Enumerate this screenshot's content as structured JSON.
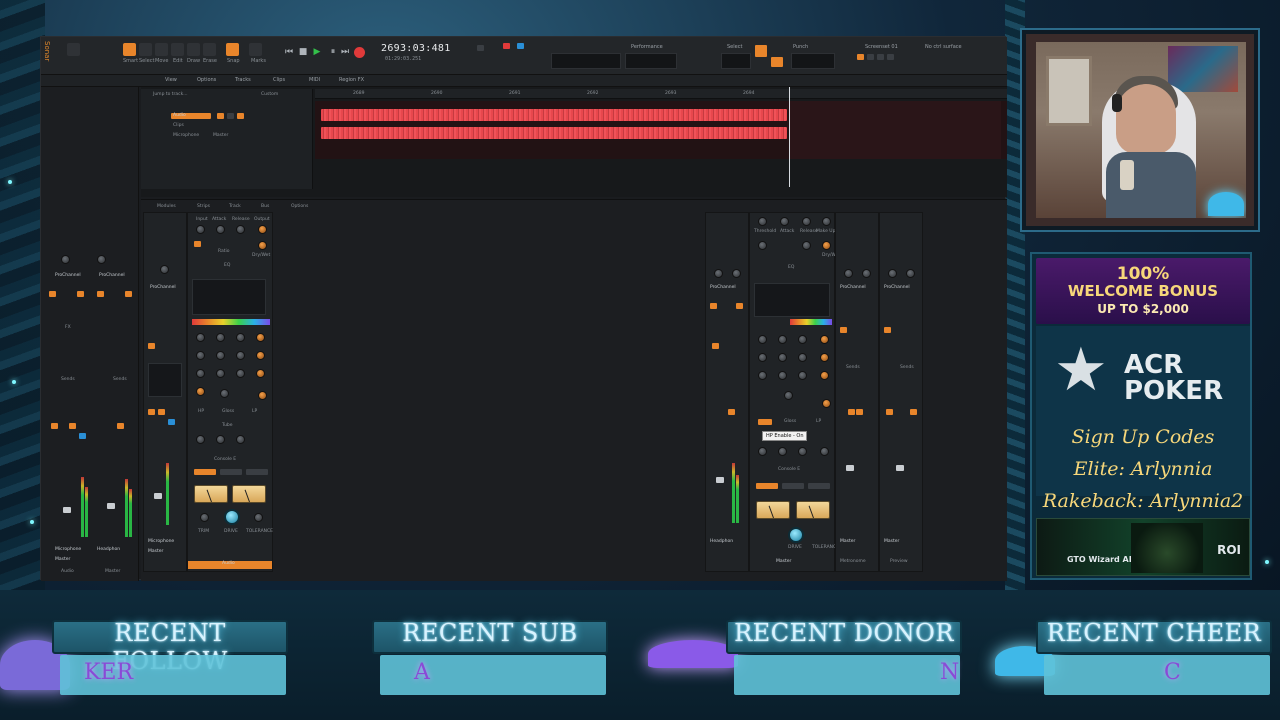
{
  "daw": {
    "transport_time": "2693:03:481",
    "transport_sub": "01:29:03.251",
    "top_labels": {
      "performance": "Performance",
      "select": "Select",
      "punch": "Punch",
      "screenset": "Screenset 01",
      "no_ctrl": "No ctrl surface"
    },
    "tool_labels": [
      "Smart",
      "Select",
      "Move",
      "Edit",
      "Draw",
      "Erase",
      "Snap",
      "Marks"
    ],
    "menu": [
      "View",
      "Options",
      "Tracks",
      "Clips",
      "MIDI",
      "Region FX"
    ],
    "console_menu": [
      "Modules",
      "Strips",
      "Track",
      "Bus",
      "Options"
    ],
    "track": {
      "name": "Audio",
      "sub1": "Clips",
      "sub2": "Microphone",
      "sub3": "Master"
    },
    "jump_label": "Jump to track...",
    "custom_label": "Custom",
    "ruler": [
      "2689",
      "2690",
      "2691",
      "2692",
      "2693",
      "2694"
    ],
    "inspector": {
      "pro_channel_1": "ProChannel",
      "pro_channel_2": "ProChannel",
      "sends": "Sends",
      "fx": "FX",
      "microphone": "Microphone",
      "headphones": "Headphon",
      "master": "Master",
      "audio": "Audio",
      "master_bottom": "Master"
    },
    "strip_labels": {
      "input": "Input",
      "attack": "Attack",
      "release": "Release",
      "output": "Output",
      "ratio": "Ratio",
      "drywet": "Dry/Wet",
      "threshold": "Threshold",
      "makeup": "Make Up",
      "eq": "EQ",
      "hp": "HP",
      "gloss": "Gloss",
      "lp": "LP",
      "tube": "Tube",
      "console": "Console E",
      "trim": "TRIM",
      "drive": "DRIVE",
      "tolerance": "TOLERANCE",
      "microphone": "Microphone",
      "master": "Master",
      "audio": "Audio",
      "headphones": "Headphon",
      "metronome": "Metronome",
      "preview": "Preview"
    },
    "tooltip": "HP Enable - On"
  },
  "ad": {
    "bonus_line1": "100%",
    "bonus_line2": "WELCOME BONUS",
    "bonus_line3": "UP TO $2,000",
    "brand_line1": "ACR",
    "brand_line2": "POKER",
    "script_line1": "Sign Up Codes",
    "script_line2": "Elite: Arlynnia",
    "script_line3": "Rakeback: Arlynnia2",
    "gto_label": "GTO Wizard AI",
    "roi_label": "ROI"
  },
  "banners": [
    {
      "title": "RECENT FOLLOW",
      "value": "KER"
    },
    {
      "title": "RECENT SUB",
      "value": "A"
    },
    {
      "title": "RECENT DONOR",
      "value": "N"
    },
    {
      "title": "RECENT CHEER",
      "value": "C"
    }
  ],
  "colors": {
    "accent_orange": "#e8852b",
    "waveform_red": "#e8474d",
    "banner_glow": "#5fd8ff"
  }
}
